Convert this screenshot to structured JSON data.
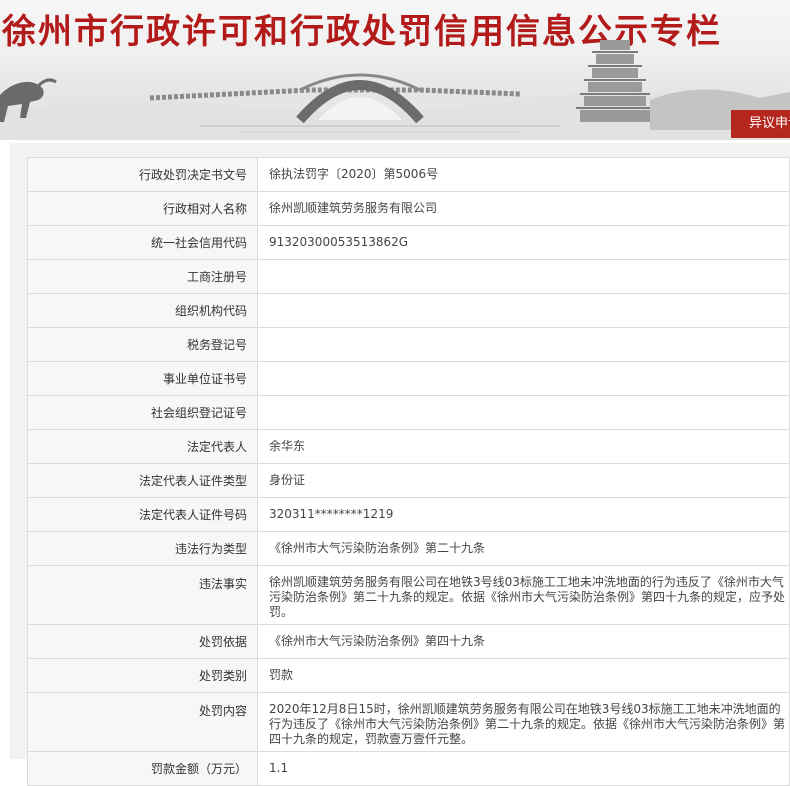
{
  "header": {
    "title": "徐州市行政许可和行政处罚信用信息公示专栏",
    "objection_button": "异议申诉"
  },
  "record": [
    {
      "label": "行政处罚决定书文号",
      "value": "徐执法罚字〔2020〕第5006号"
    },
    {
      "label": "行政相对人名称",
      "value": "徐州凯顺建筑劳务服务有限公司"
    },
    {
      "label": "统一社会信用代码",
      "value": "91320300053513862G"
    },
    {
      "label": "工商注册号",
      "value": ""
    },
    {
      "label": "组织机构代码",
      "value": ""
    },
    {
      "label": "税务登记号",
      "value": ""
    },
    {
      "label": "事业单位证书号",
      "value": ""
    },
    {
      "label": "社会组织登记证号",
      "value": ""
    },
    {
      "label": "法定代表人",
      "value": "余华东"
    },
    {
      "label": "法定代表人证件类型",
      "value": "身份证"
    },
    {
      "label": "法定代表人证件号码",
      "value": "320311********1219"
    },
    {
      "label": "违法行为类型",
      "value": "《徐州市大气污染防治条例》第二十九条"
    },
    {
      "label": "违法事实",
      "value": "徐州凯顺建筑劳务服务有限公司在地铁3号线03标施工工地未冲洗地面的行为违反了《徐州市大气污染防治条例》第二十九条的规定。依据《徐州市大气污染防治条例》第四十九条的规定，应予处罚。"
    },
    {
      "label": "处罚依据",
      "value": "《徐州市大气污染防治条例》第四十九条"
    },
    {
      "label": "处罚类别",
      "value": "罚款"
    },
    {
      "label": "处罚内容",
      "value": "2020年12月8日15时，徐州凯顺建筑劳务服务有限公司在地铁3号线03标施工工地未冲洗地面的行为违反了《徐州市大气污染防治条例》第二十九条的规定。依据《徐州市大气污染防治条例》第四十九条的规定，罚款壹万壹仟元整。"
    },
    {
      "label": "罚款金额（万元）",
      "value": "1.1"
    }
  ]
}
